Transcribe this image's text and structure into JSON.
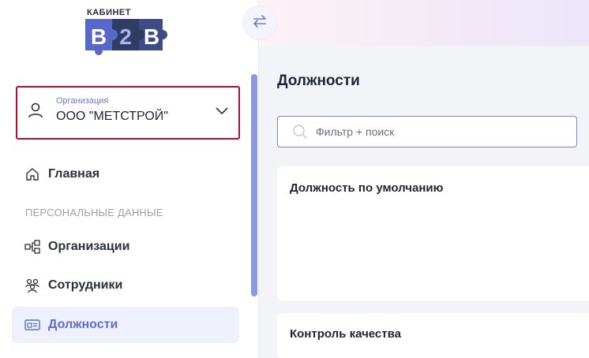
{
  "logo": {
    "caption": "КАБИНЕТ",
    "letters": [
      "B",
      "2",
      "B"
    ]
  },
  "sidebar": {
    "organization": {
      "caption": "Организация",
      "name": "ООО \"МЕТСТРОЙ\""
    },
    "nav": {
      "home": "Главная",
      "section": "ПЕРСОНАЛЬНЫЕ ДАННЫЕ",
      "organizations": "Организации",
      "employees": "Сотрудники",
      "positions": "Должности"
    }
  },
  "main": {
    "title": "Должности",
    "search": {
      "placeholder": "Фильтр + поиск"
    },
    "cards": [
      "Должность по умолчанию",
      "Контроль качества"
    ]
  },
  "colors": {
    "accent": "#5d6ccf",
    "highlight_border": "#b0102a",
    "logo_dark": "#2f3c63",
    "logo_blue": "#5867c9"
  }
}
